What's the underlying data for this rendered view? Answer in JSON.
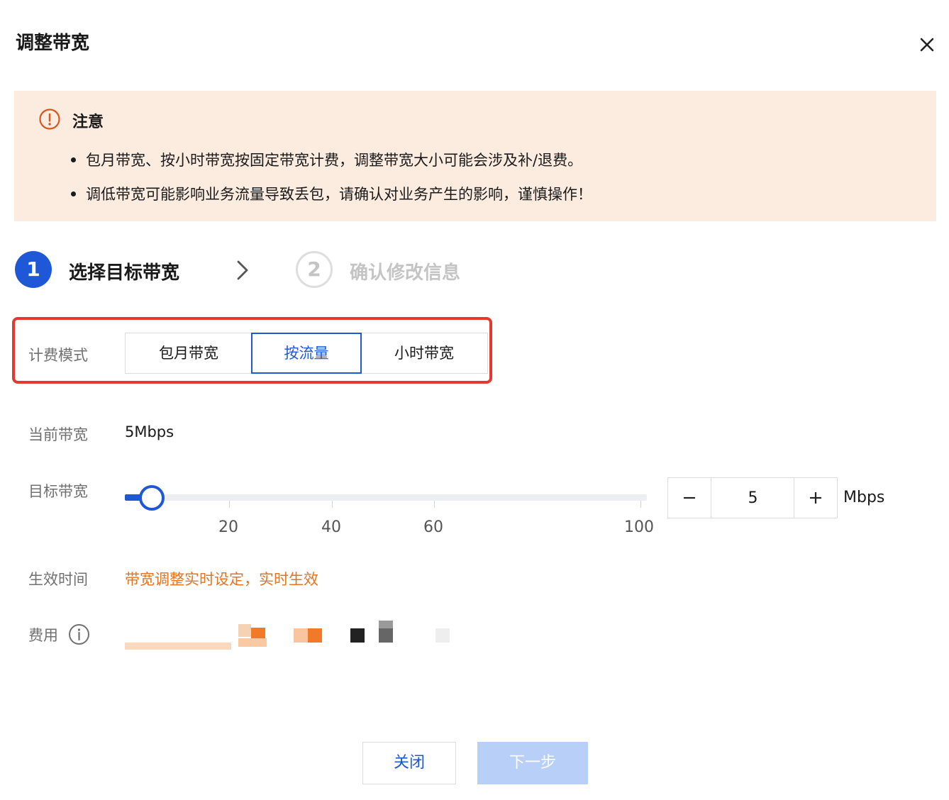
{
  "dialog": {
    "title": "调整带宽"
  },
  "notice": {
    "title": "注意",
    "items": [
      "包月带宽、按小时带宽按固定带宽计费，调整带宽大小可能会涉及补/退费。",
      "调低带宽可能影响业务流量导致丢包，请确认对业务产生的影响，谨慎操作！"
    ],
    "accent_color": "#d9561f",
    "background_color": "#fcece0"
  },
  "steps": [
    {
      "number": "1",
      "label": "选择目标带宽",
      "active": true
    },
    {
      "number": "2",
      "label": "确认修改信息",
      "active": false
    }
  ],
  "billing": {
    "label": "计费模式",
    "options": [
      "包月带宽",
      "按流量",
      "小时带宽"
    ],
    "selected": "按流量"
  },
  "current_bandwidth": {
    "label": "当前带宽",
    "value": "5Mbps"
  },
  "target_bandwidth": {
    "label": "目标带宽",
    "value": "5",
    "unit": "Mbps",
    "slider": {
      "min": 1,
      "max": 100,
      "value": 5,
      "tick_labels": [
        "20",
        "40",
        "60",
        "100"
      ]
    }
  },
  "effective_time": {
    "label": "生效时间",
    "value": "带宽调整实时设定，实时生效"
  },
  "fee": {
    "label": "费用"
  },
  "footer": {
    "close_label": "关闭",
    "next_label": "下一步"
  },
  "colors": {
    "primary": "#1f58d6",
    "highlight_border": "#e23a2e",
    "effect_text": "#e8721e",
    "disabled_button": "#b8cff7"
  }
}
